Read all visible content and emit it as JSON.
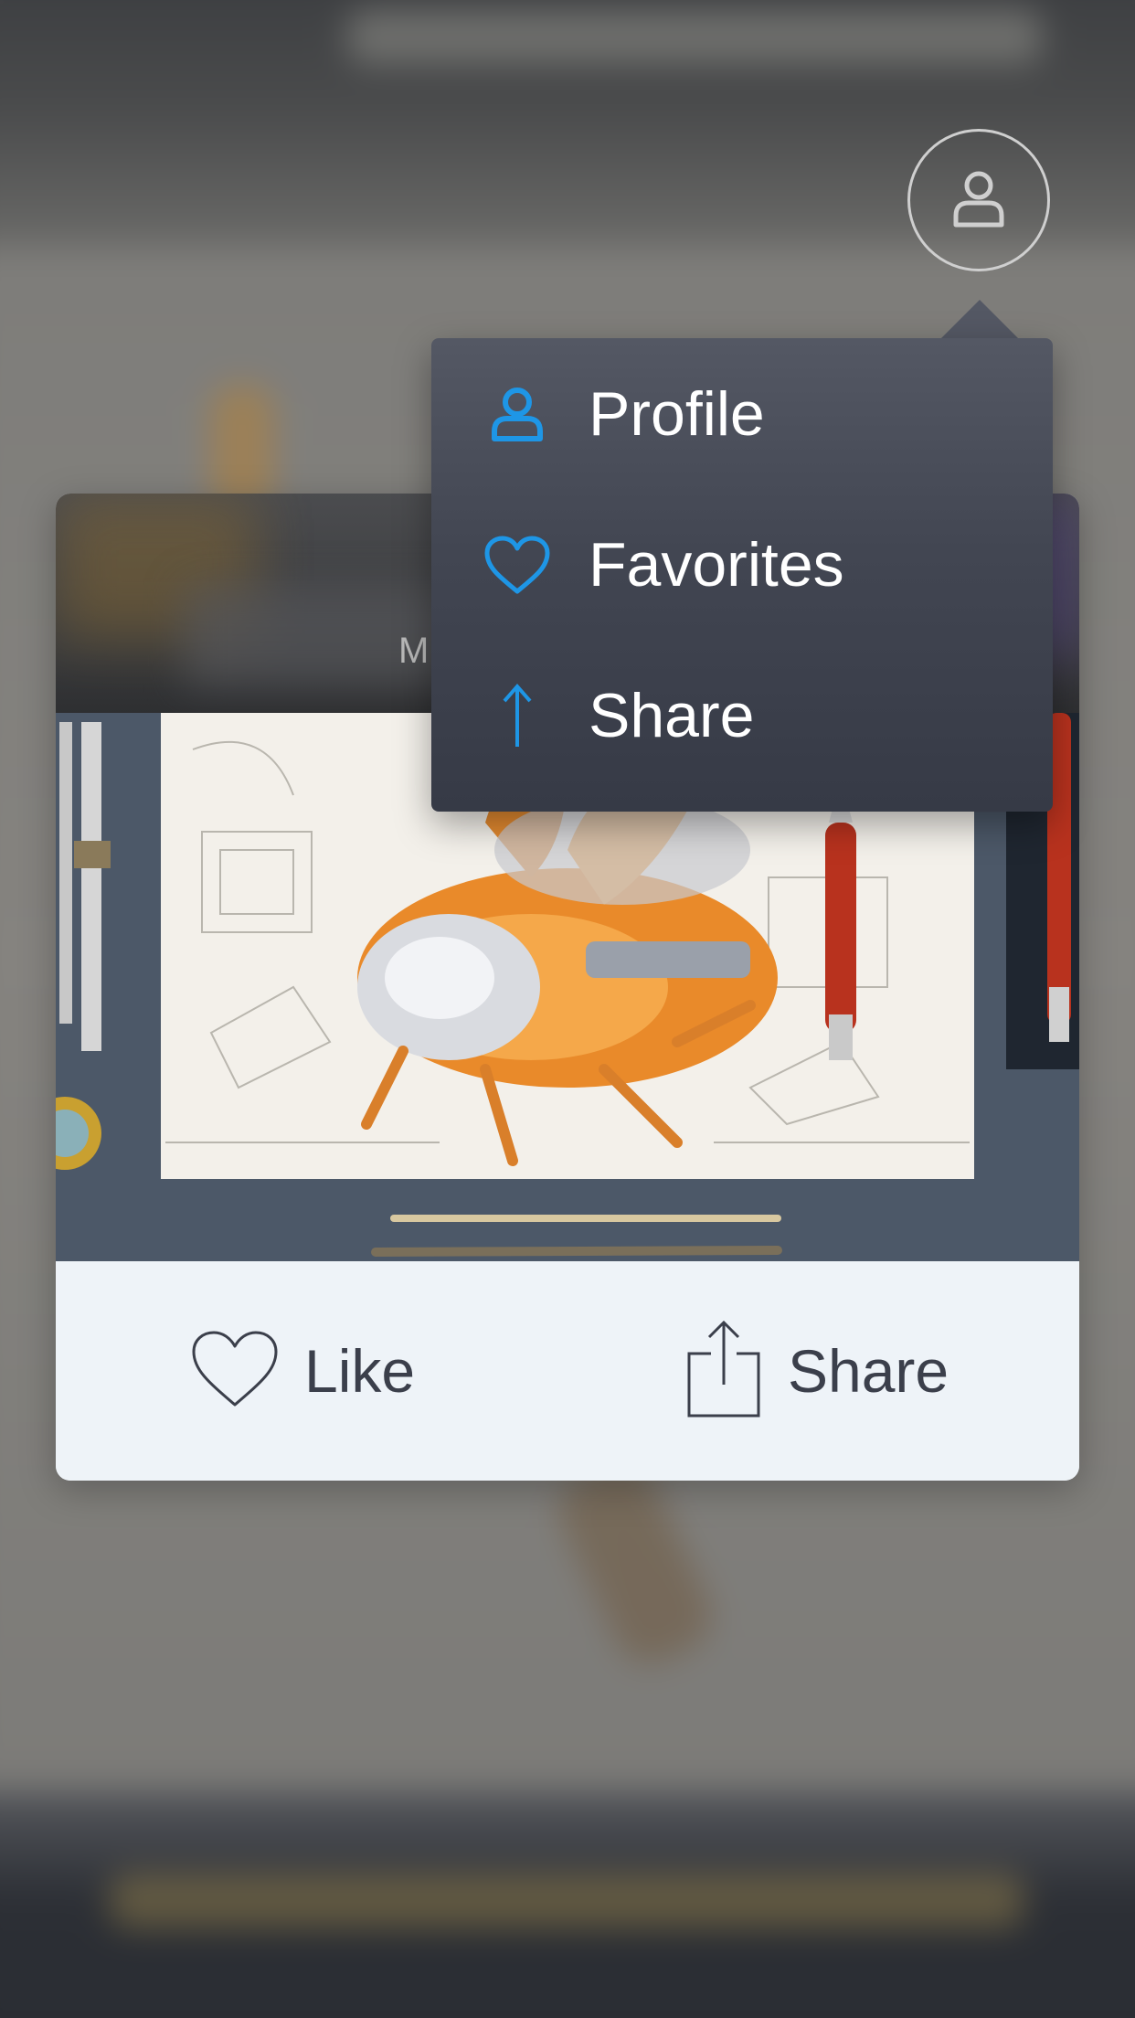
{
  "avatar": {
    "icon": "user-icon"
  },
  "card": {
    "title_partial": "M",
    "actions": {
      "like_label": "Like",
      "share_label": "Share"
    }
  },
  "menu": {
    "items": [
      {
        "label": "Profile",
        "icon": "user-icon"
      },
      {
        "label": "Favorites",
        "icon": "heart-icon"
      },
      {
        "label": "Share",
        "icon": "arrow-up-icon"
      }
    ]
  },
  "colors": {
    "accent": "#1e96e6",
    "menu_bg": "#454955",
    "card_actions_bg": "#eef3f8",
    "action_text": "#3b3f4b"
  }
}
